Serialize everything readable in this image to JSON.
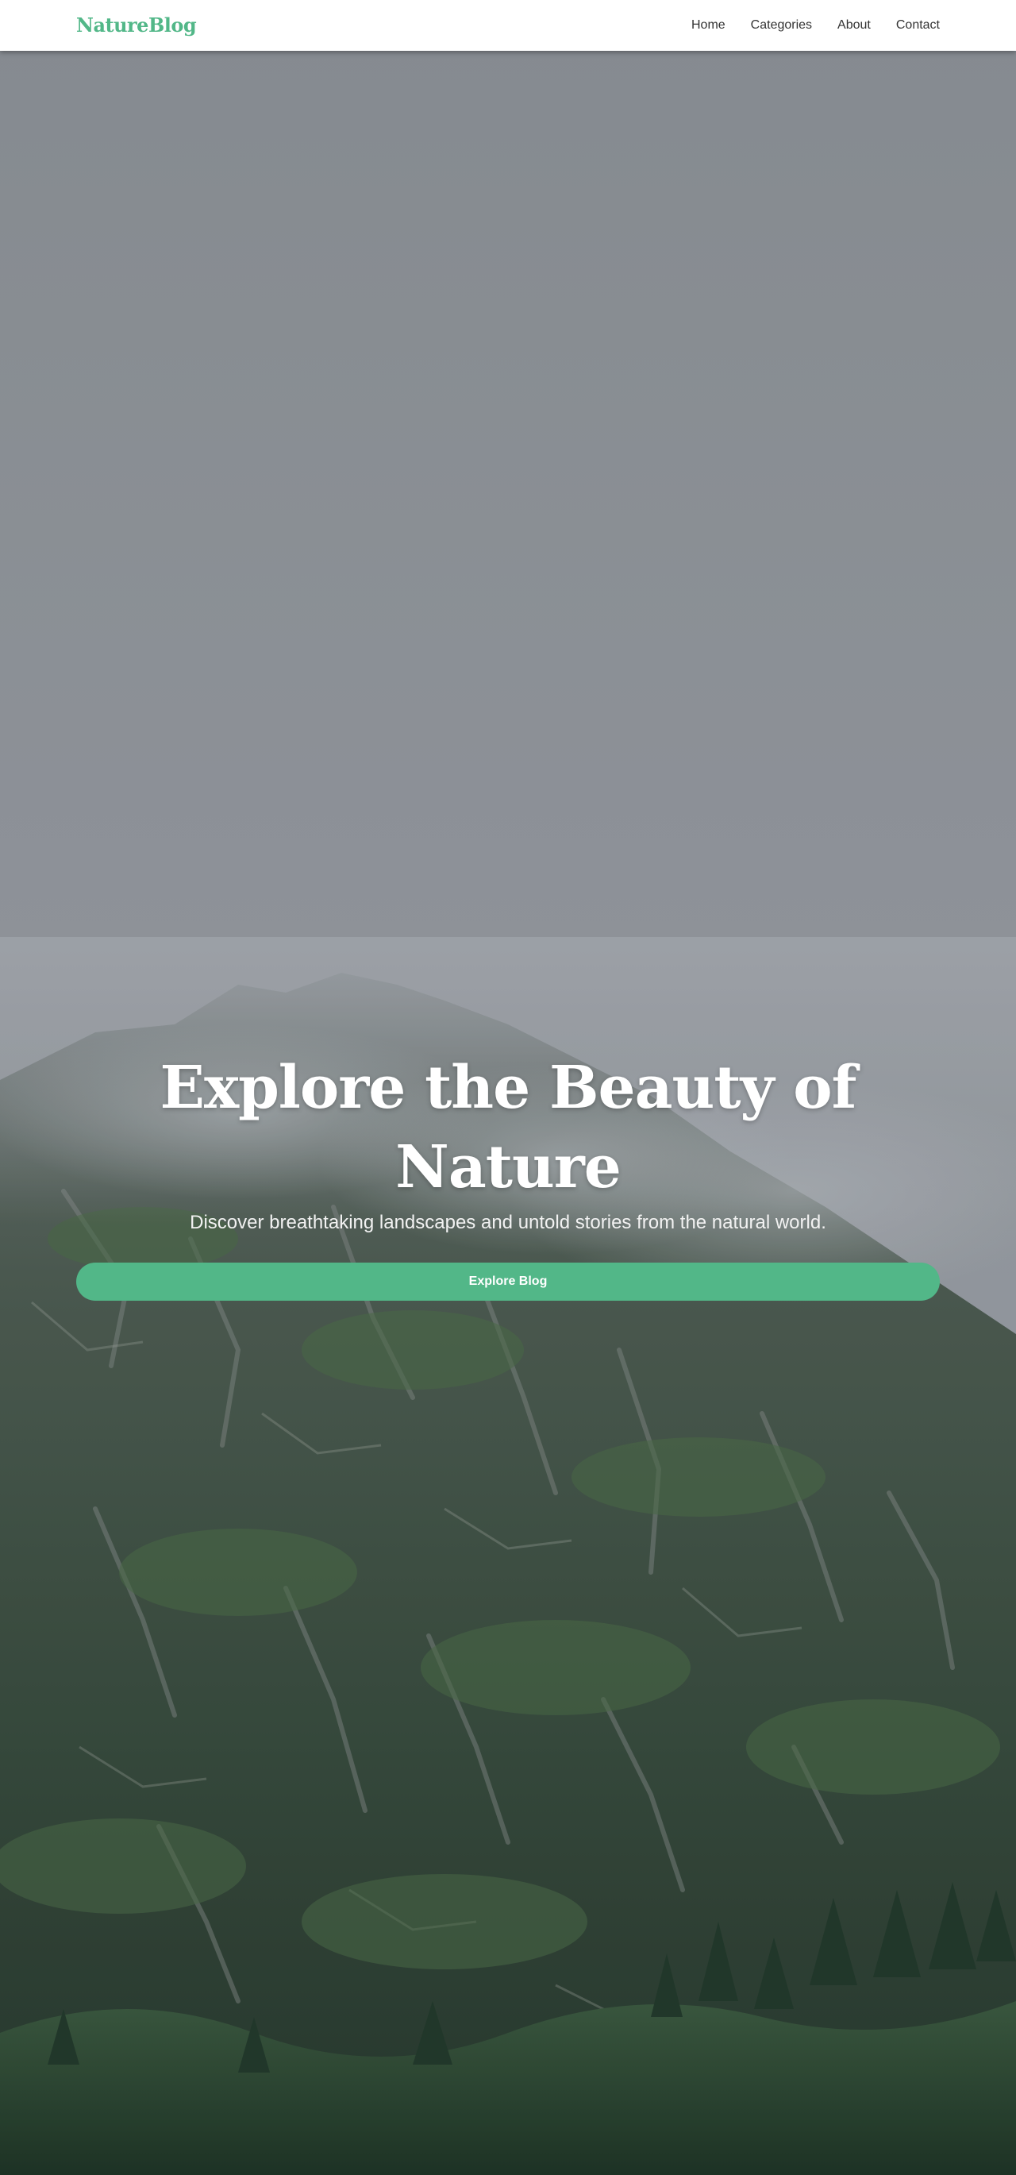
{
  "brand": {
    "logo_text": "NatureBlog",
    "accent_color": "#52b788"
  },
  "nav": {
    "items": [
      {
        "label": "Home"
      },
      {
        "label": "Categories"
      },
      {
        "label": "About"
      },
      {
        "label": "Contact"
      }
    ]
  },
  "hero": {
    "background_image": "foggy-mountain-landscape",
    "title": "Explore the Beauty of Nature",
    "subtitle": "Discover breathtaking landscapes and untold stories from the natural world.",
    "cta_label": "Explore Blog"
  }
}
